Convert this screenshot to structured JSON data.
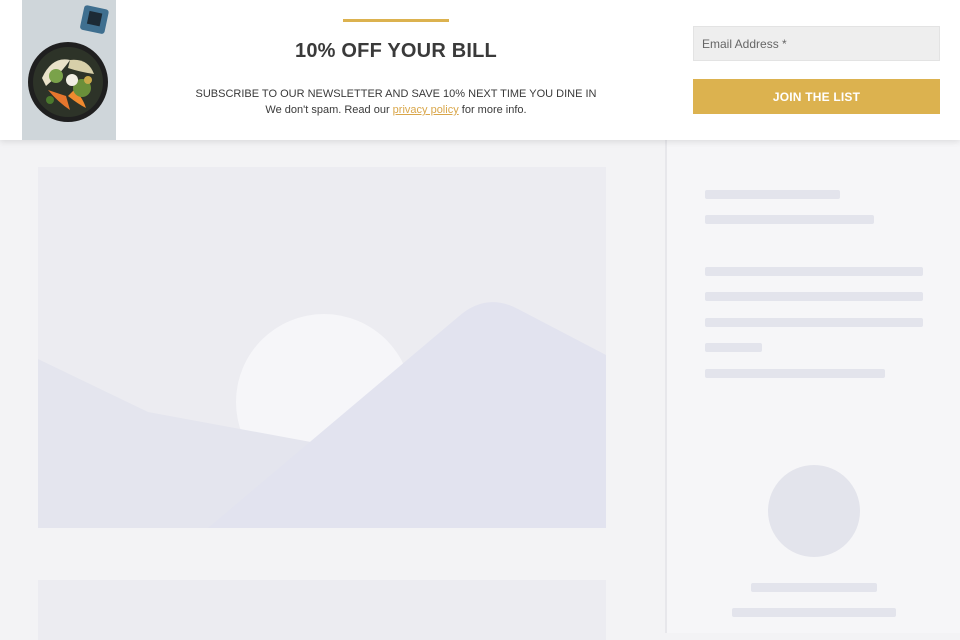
{
  "newsletter": {
    "title": "10% OFF YOUR BILL",
    "subtitle": "SUBSCRIBE TO OUR NEWSLETTER AND SAVE 10% NEXT TIME YOU DINE IN",
    "note_prefix": "We don't spam. Read our",
    "privacy_link": "privacy policy",
    "note_suffix": "for more info.",
    "email_placeholder": "Email Address *",
    "email_value": "",
    "join_label": "JOIN THE LIST",
    "image_icon": "food-bowl-image"
  },
  "colors": {
    "accent": "#dcb24f",
    "link": "#d9a64a",
    "skeleton": "#e3e4ec",
    "page_bg": "#f3f3f5"
  }
}
